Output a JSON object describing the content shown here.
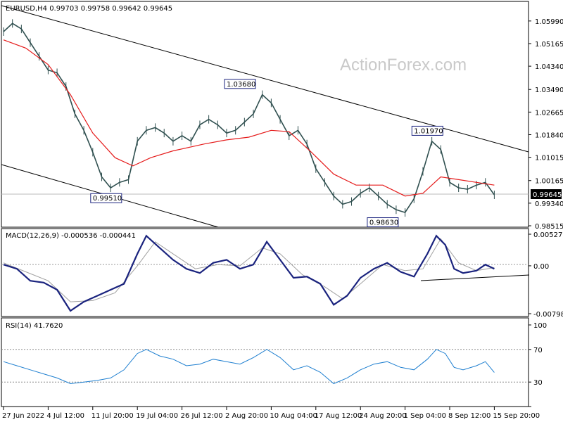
{
  "colors": {
    "price": "#2f4f4f",
    "ma": "#e51c1c",
    "channel": "#000000",
    "macd_main": "#1a237e",
    "macd_signal": "#a0a0a0",
    "rsi": "#1e7fd0",
    "level": "#8c8c8c",
    "box_border": "#1a237e"
  },
  "watermark": "ActionForex.com",
  "chart_data": [
    {
      "type": "line",
      "title": "EURUSD,H4  0.99703 0.99758 0.99642 0.99645",
      "symbol": "EURUSD",
      "timeframe": "H4",
      "ohlc": {
        "open": 0.99703,
        "high": 0.99758,
        "low": 0.99642,
        "close": 0.99645
      },
      "current_price_label": "0.99645",
      "ylim": [
        0.98515,
        1.0614
      ],
      "y_ticks": [
        "1.05990",
        "1.05165",
        "1.04340",
        "1.03490",
        "1.02665",
        "1.01840",
        "1.01015",
        "1.00165",
        "0.99340",
        "0.98515"
      ],
      "x_ticks": [
        "27 Jun 2022",
        "4 Jul 12:00",
        "11 Jul 20:00",
        "19 Jul 04:00",
        "26 Jul 12:00",
        "2 Aug 20:00",
        "10 Aug 04:00",
        "17 Aug 12:00",
        "24 Aug 20:00",
        "1 Sep 04:00",
        "8 Sep 12:00",
        "15 Sep 20:00"
      ],
      "annotations": [
        {
          "text": "0.99510",
          "at_tick": 2.3,
          "value": 0.9951
        },
        {
          "text": "1.03680",
          "at_tick": 5.3,
          "value": 1.0368
        },
        {
          "text": "0.98630",
          "at_tick": 8.5,
          "value": 0.9863
        },
        {
          "text": "1.01970",
          "at_tick": 9.5,
          "value": 1.0197
        }
      ],
      "price_points": [
        [
          0,
          1.056
        ],
        [
          0.2,
          1.059
        ],
        [
          0.4,
          1.057
        ],
        [
          0.6,
          1.052
        ],
        [
          0.8,
          1.047
        ],
        [
          1.0,
          1.042
        ],
        [
          1.2,
          1.041
        ],
        [
          1.4,
          1.036
        ],
        [
          1.6,
          1.026
        ],
        [
          1.8,
          1.02
        ],
        [
          2.0,
          1.012
        ],
        [
          2.2,
          1.003
        ],
        [
          2.4,
          0.999
        ],
        [
          2.6,
          1.001
        ],
        [
          2.8,
          1.002
        ],
        [
          3.0,
          1.016
        ],
        [
          3.2,
          1.02
        ],
        [
          3.4,
          1.021
        ],
        [
          3.6,
          1.019
        ],
        [
          3.8,
          1.016
        ],
        [
          4.0,
          1.018
        ],
        [
          4.2,
          1.016
        ],
        [
          4.4,
          1.022
        ],
        [
          4.6,
          1.024
        ],
        [
          4.8,
          1.022
        ],
        [
          5.0,
          1.019
        ],
        [
          5.2,
          1.02
        ],
        [
          5.4,
          1.023
        ],
        [
          5.6,
          1.026
        ],
        [
          5.8,
          1.033
        ],
        [
          6.0,
          1.03
        ],
        [
          6.2,
          1.024
        ],
        [
          6.4,
          1.018
        ],
        [
          6.6,
          1.02
        ],
        [
          6.8,
          1.015
        ],
        [
          7.0,
          1.006
        ],
        [
          7.2,
          1.001
        ],
        [
          7.4,
          0.996
        ],
        [
          7.6,
          0.993
        ],
        [
          7.8,
          0.994
        ],
        [
          8.0,
          0.997
        ],
        [
          8.2,
          0.999
        ],
        [
          8.4,
          0.996
        ],
        [
          8.6,
          0.993
        ],
        [
          8.8,
          0.991
        ],
        [
          9.0,
          0.99
        ],
        [
          9.2,
          0.995
        ],
        [
          9.4,
          1.005
        ],
        [
          9.6,
          1.016
        ],
        [
          9.8,
          1.013
        ],
        [
          10.0,
          1.001
        ],
        [
          10.2,
          0.999
        ],
        [
          10.4,
          0.9985
        ],
        [
          10.6,
          1.0
        ],
        [
          10.8,
          1.001
        ],
        [
          11.0,
          0.99645
        ]
      ],
      "ma_points": [
        [
          0,
          1.053
        ],
        [
          0.5,
          1.05
        ],
        [
          1.0,
          1.044
        ],
        [
          1.5,
          1.033
        ],
        [
          2.0,
          1.019
        ],
        [
          2.5,
          1.01
        ],
        [
          2.9,
          1.007
        ],
        [
          3.3,
          1.01
        ],
        [
          3.8,
          1.0125
        ],
        [
          4.5,
          1.015
        ],
        [
          5.0,
          1.0165
        ],
        [
          5.5,
          1.0175
        ],
        [
          6.0,
          1.02
        ],
        [
          6.4,
          1.0195
        ],
        [
          6.9,
          1.012
        ],
        [
          7.4,
          1.004
        ],
        [
          7.9,
          1.0
        ],
        [
          8.5,
          1.0
        ],
        [
          9.0,
          0.996
        ],
        [
          9.4,
          0.997
        ],
        [
          9.8,
          1.003
        ],
        [
          10.2,
          1.002
        ],
        [
          10.6,
          1.001
        ],
        [
          11.0,
          1.0
        ]
      ]
    },
    {
      "type": "line",
      "title": "MACD(12,26,9) -0.000536 -0.000441",
      "indicator": "MACD",
      "params": "12,26,9",
      "values": {
        "macd": -0.000536,
        "signal": -0.000441
      },
      "ylim": [
        -0.007984,
        0.00527
      ],
      "y_ticks": [
        "0.00527",
        "0.00",
        "-0.007984"
      ],
      "series": [
        {
          "points": [
            [
              0,
              0.0002
            ],
            [
              0.3,
              -0.0005
            ],
            [
              0.6,
              -0.0025
            ],
            [
              0.9,
              -0.0028
            ],
            [
              1.2,
              -0.004
            ],
            [
              1.5,
              -0.0075
            ],
            [
              1.8,
              -0.006
            ],
            [
              2.1,
              -0.005
            ],
            [
              2.4,
              -0.004
            ],
            [
              2.7,
              -0.003
            ],
            [
              3.0,
              0.002
            ],
            [
              3.2,
              0.005
            ],
            [
              3.5,
              0.003
            ],
            [
              3.8,
              0.001
            ],
            [
              4.1,
              -0.0005
            ],
            [
              4.4,
              -0.0012
            ],
            [
              4.7,
              0.0005
            ],
            [
              5.0,
              0.001
            ],
            [
              5.3,
              -0.0005
            ],
            [
              5.6,
              0.0002
            ],
            [
              5.9,
              0.004
            ],
            [
              6.2,
              0.001
            ],
            [
              6.5,
              -0.002
            ],
            [
              6.8,
              -0.0018
            ],
            [
              7.1,
              -0.003
            ],
            [
              7.4,
              -0.0065
            ],
            [
              7.7,
              -0.005
            ],
            [
              8.0,
              -0.002
            ],
            [
              8.3,
              -0.0005
            ],
            [
              8.6,
              0.0005
            ],
            [
              8.9,
              -0.001
            ],
            [
              9.2,
              -0.0018
            ],
            [
              9.5,
              0.002
            ],
            [
              9.7,
              0.005
            ],
            [
              9.9,
              0.0035
            ],
            [
              10.1,
              -0.0005
            ],
            [
              10.3,
              -0.0012
            ],
            [
              10.6,
              -0.0008
            ],
            [
              10.8,
              0.0002
            ],
            [
              11.0,
              -0.0005
            ]
          ]
        },
        {
          "points": [
            [
              0,
              0.0005
            ],
            [
              0.5,
              -0.001
            ],
            [
              1.0,
              -0.0025
            ],
            [
              1.5,
              -0.006
            ],
            [
              2.0,
              -0.0058
            ],
            [
              2.5,
              -0.0045
            ],
            [
              3.0,
              0.0
            ],
            [
              3.4,
              0.004
            ],
            [
              3.8,
              0.002
            ],
            [
              4.3,
              -0.0005
            ],
            [
              4.8,
              0.0002
            ],
            [
              5.3,
              0.0
            ],
            [
              5.8,
              0.003
            ],
            [
              6.2,
              0.002
            ],
            [
              6.7,
              -0.0015
            ],
            [
              7.2,
              -0.0035
            ],
            [
              7.6,
              -0.0055
            ],
            [
              8.0,
              -0.003
            ],
            [
              8.5,
              0.0002
            ],
            [
              9.0,
              -0.0008
            ],
            [
              9.4,
              -0.0005
            ],
            [
              9.8,
              0.0045
            ],
            [
              10.2,
              0.0005
            ],
            [
              10.6,
              -0.0008
            ],
            [
              11.0,
              -0.0003
            ]
          ]
        }
      ]
    },
    {
      "type": "line",
      "title": "RSI(14) 41.7620",
      "indicator": "RSI",
      "params": "14",
      "value": 41.762,
      "ylim": [
        0,
        100
      ],
      "y_ticks": [
        "100",
        "70",
        "30",
        "0"
      ],
      "levels": [
        70,
        30
      ],
      "series": [
        {
          "points": [
            [
              0,
              55
            ],
            [
              0.3,
              50
            ],
            [
              0.6,
              45
            ],
            [
              0.9,
              40
            ],
            [
              1.2,
              35
            ],
            [
              1.5,
              28
            ],
            [
              1.8,
              30
            ],
            [
              2.1,
              32
            ],
            [
              2.4,
              35
            ],
            [
              2.7,
              45
            ],
            [
              3.0,
              65
            ],
            [
              3.2,
              70
            ],
            [
              3.5,
              62
            ],
            [
              3.8,
              58
            ],
            [
              4.1,
              50
            ],
            [
              4.4,
              52
            ],
            [
              4.7,
              58
            ],
            [
              5.0,
              55
            ],
            [
              5.3,
              52
            ],
            [
              5.6,
              60
            ],
            [
              5.9,
              70
            ],
            [
              6.2,
              60
            ],
            [
              6.5,
              45
            ],
            [
              6.8,
              50
            ],
            [
              7.1,
              42
            ],
            [
              7.4,
              28
            ],
            [
              7.7,
              35
            ],
            [
              8.0,
              45
            ],
            [
              8.3,
              52
            ],
            [
              8.6,
              55
            ],
            [
              8.9,
              48
            ],
            [
              9.2,
              45
            ],
            [
              9.5,
              58
            ],
            [
              9.7,
              70
            ],
            [
              9.9,
              65
            ],
            [
              10.1,
              48
            ],
            [
              10.3,
              45
            ],
            [
              10.6,
              50
            ],
            [
              10.8,
              55
            ],
            [
              11.0,
              41.762
            ]
          ]
        }
      ]
    }
  ]
}
